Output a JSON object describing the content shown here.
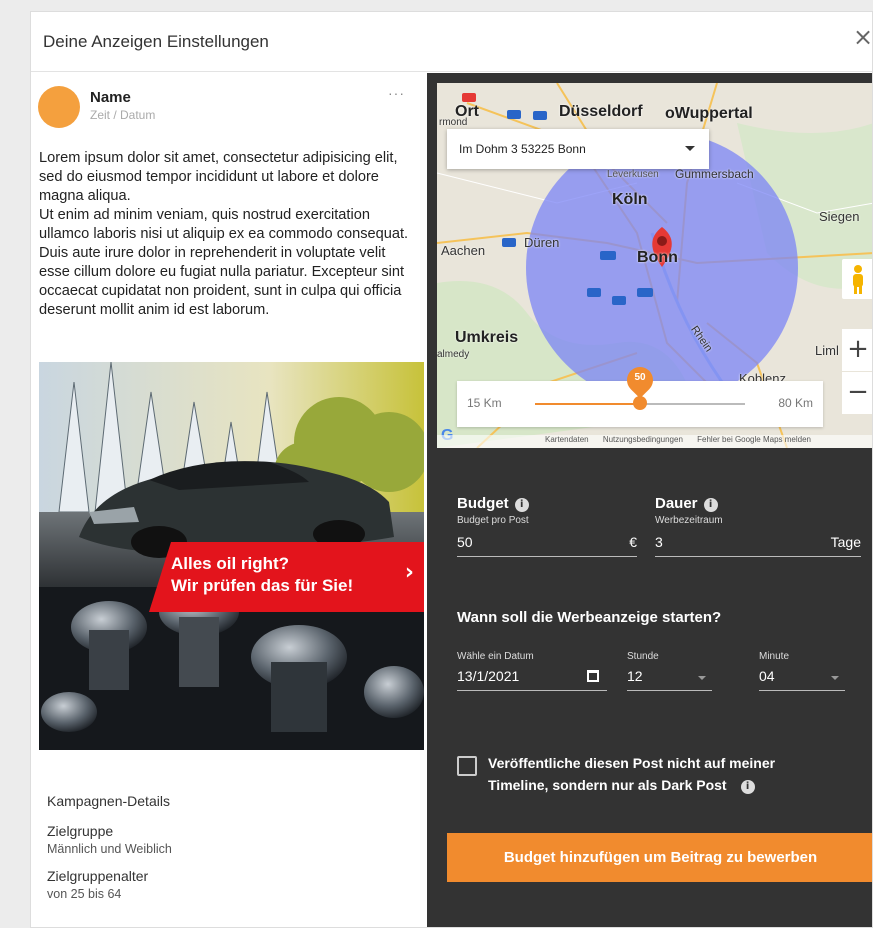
{
  "modal": {
    "title": "Deine Anzeigen Einstellungen",
    "close_icon": "×"
  },
  "post": {
    "name": "Name",
    "time": "Zeit / Datum",
    "menu": "···",
    "body_p1": "Lorem ipsum dolor sit amet, consectetur adipisicing elit, sed do eiusmod tempor incididunt ut labore et dolore magna aliqua.",
    "body_p2": "Ut enim ad minim veniam, quis nostrud exercitation ullamco laboris nisi ut aliquip ex ea commodo consequat. Duis aute irure dolor in reprehenderit in voluptate velit esse cillum dolore eu fugiat nulla pariatur. Excepteur sint occaecat cupidatat non proident, sunt in culpa qui officia deserunt mollit anim id est laborum.",
    "ad_line1": "Alles oil right?",
    "ad_line2": "Wir prüfen das für Sie!",
    "ad_arrow": "›"
  },
  "details": {
    "title": "Kampagnen-Details",
    "target_label": "Zielgruppe",
    "target_value": "Männlich und Weiblich",
    "age_label": "Zielgruppenalter",
    "age_value": "von 25 bis 64"
  },
  "map": {
    "address": "Im Dohm 3 53225 Bonn",
    "labels": {
      "duesseldorf": "Düsseldorf",
      "wuppertal": "oWuppertal",
      "ort": "Ort",
      "rmond": "rmond",
      "koeln": "Köln",
      "gummersbach": "Gummersbach",
      "siegen": "Siegen",
      "aachen": "Aachen",
      "dueren": "Düren",
      "bonn": "Bonn",
      "umkreis": "Umkreis",
      "malmedy": "almedy",
      "koblenz": "Koblenz",
      "leverkusen": "Leverkusen",
      "limburg": "Liml",
      "rhein": "Rhein"
    },
    "zoom_in": "+",
    "zoom_out": "−",
    "radius_min": "15 Km",
    "radius_max": "80 Km",
    "radius_value": "50",
    "radius_fraction": 0.5,
    "google_logo": "G",
    "footer": [
      "Kartendaten",
      "Nutzungsbedingungen",
      "Fehler bei Google Maps melden"
    ],
    "colors": {
      "radius_fill": "#7b84f5",
      "pin": "#e53935",
      "accent": "#f18b2e"
    }
  },
  "form": {
    "budget_label": "Budget",
    "budget_sub": "Budget pro Post",
    "budget_value": "50",
    "budget_suffix": "€",
    "duration_label": "Dauer",
    "duration_sub": "Werbezeitraum",
    "duration_value": "3",
    "duration_suffix": "Tage",
    "info_icon": "i",
    "start_title": "Wann soll die Werbeanzeige starten?",
    "date_label": "Wähle ein Datum",
    "date_value": "13/1/2021",
    "hour_label": "Stunde",
    "hour_value": "12",
    "minute_label": "Minute",
    "minute_value": "04",
    "darkpost_line1": "Veröffentliche diesen Post nicht auf meiner",
    "darkpost_line2": "Timeline, sondern nur als Dark Post",
    "cta": "Budget hinzufügen um Beitrag zu bewerben"
  }
}
